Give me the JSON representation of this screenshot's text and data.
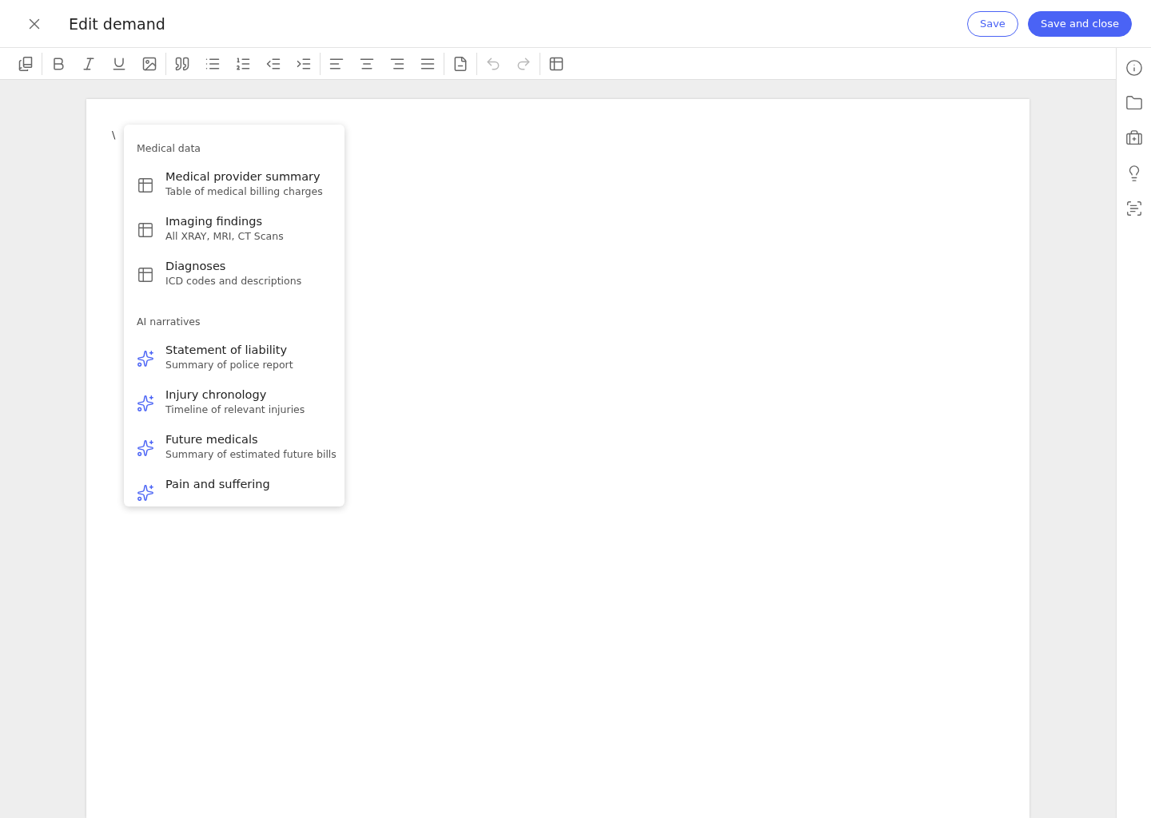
{
  "header": {
    "title": "Edit demand",
    "buttons": [
      {
        "label": "Save",
        "kind": "outline"
      },
      {
        "label": "Save and close",
        "kind": "primary"
      }
    ]
  },
  "toolbar": {
    "groups": [
      [
        {
          "disabled": false
        }
      ],
      [
        {
          "disabled": false
        },
        {
          "disabled": false
        },
        {
          "disabled": false
        },
        {
          "disabled": false
        }
      ],
      [
        {
          "disabled": false
        },
        {
          "disabled": false
        },
        {
          "disabled": false
        },
        {
          "disabled": false
        },
        {
          "disabled": false
        }
      ],
      [
        {
          "disabled": false
        },
        {
          "disabled": false
        },
        {
          "disabled": false
        },
        {
          "disabled": false
        }
      ],
      [
        {
          "disabled": false
        }
      ],
      [
        {
          "disabled": true
        },
        {
          "disabled": true
        }
      ],
      [
        {
          "disabled": false
        }
      ]
    ]
  },
  "editor": {
    "typed_text": "\\"
  },
  "menu": {
    "sections": [
      {
        "heading": "Medical data",
        "items": [
          {
            "kind": "table",
            "title": "Medical provider summary",
            "subtitle": "Table of medical billing charges"
          },
          {
            "kind": "table",
            "title": "Imaging findings",
            "subtitle": "All XRAY, MRI, CT Scans"
          },
          {
            "kind": "table",
            "title": "Diagnoses",
            "subtitle": "ICD codes and descriptions"
          }
        ]
      },
      {
        "heading": "AI narratives",
        "items": [
          {
            "kind": "ai",
            "title": "Statement of liability",
            "subtitle": "Summary of police report"
          },
          {
            "kind": "ai",
            "title": "Injury chronology",
            "subtitle": "Timeline of relevant injuries"
          },
          {
            "kind": "ai",
            "title": "Future medicals",
            "subtitle": "Summary of estimated future bills"
          },
          {
            "kind": "ai",
            "title": "Pain and suffering"
          }
        ]
      }
    ]
  }
}
